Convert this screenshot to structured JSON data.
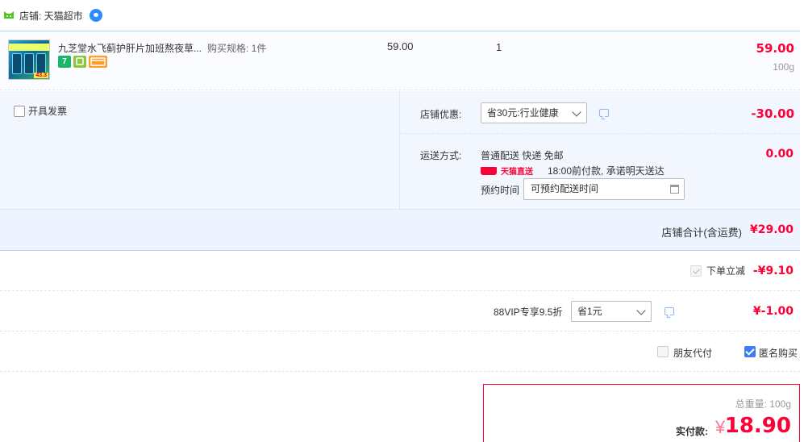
{
  "shop": {
    "label": "店铺: 天猫超市",
    "icon": "tmall-shop-icon",
    "chat_icon": "wangwang-chat-icon"
  },
  "item": {
    "title": "九芝堂水飞蓟护肝片加班熬夜草...",
    "spec": "购买规格: 1件",
    "badges": [
      "7",
      "",
      ""
    ],
    "price": "59.00",
    "qty": "1",
    "total": "59.00",
    "weight": "100g",
    "thumb_tag": "43.3"
  },
  "invoice": {
    "label": "开具发票"
  },
  "promo": {
    "label": "店铺优惠:",
    "selected": "省30元:行业健康",
    "amount": "-30.00"
  },
  "shipping": {
    "label": "运送方式:",
    "method": "普通配送 快递 免邮",
    "tag": "天猫直送",
    "promise": "18:00前付款, 承诺明天送达",
    "appt_label": "预约时间",
    "appt_value": "可预约配送时间",
    "amount": "0.00"
  },
  "subtotal": {
    "label": "店铺合计(含运费)",
    "value": "¥29.00"
  },
  "instant_discount": {
    "label": "下单立减",
    "value": "-¥9.10"
  },
  "vip": {
    "label": "88VIP专享9.5折",
    "selected": "省1元",
    "value": "¥-1.00"
  },
  "options": {
    "friend_pay": "朋友代付",
    "anonymous": "匿名购买"
  },
  "pay": {
    "weight": "总重量: 100g",
    "label": "实付款:",
    "currency": "¥",
    "amount": "18.90"
  },
  "colors": {
    "accent": "#ff0036",
    "link_blue": "#3d7cf7",
    "panel_bg": "#f2f7ff"
  }
}
